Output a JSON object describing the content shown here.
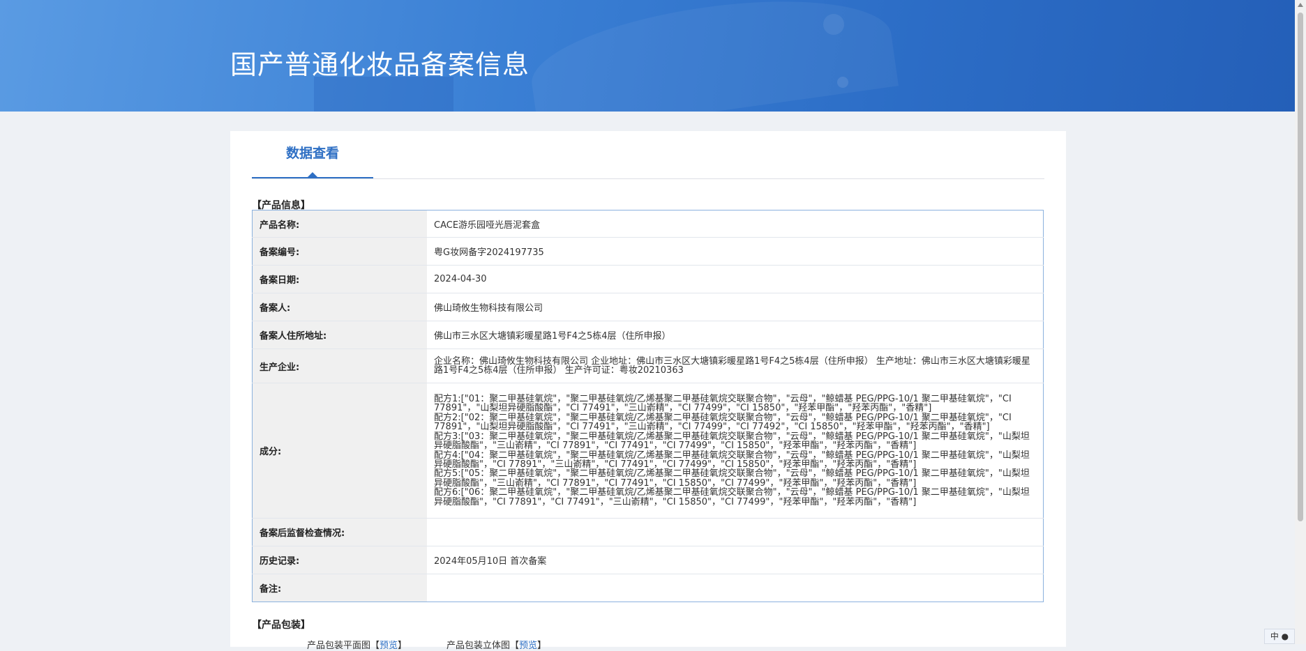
{
  "header": {
    "title": "国产普通化妆品备案信息"
  },
  "tabs": [
    {
      "label": "数据查看"
    }
  ],
  "product_info": {
    "section_title": "【产品信息】",
    "rows": [
      {
        "label": "产品名称:",
        "value": "CACE游乐园哑光唇泥套盒"
      },
      {
        "label": "备案编号:",
        "value": "粤G妆网备字2024197735"
      },
      {
        "label": "备案日期:",
        "value": "2024-04-30"
      },
      {
        "label": "备案人:",
        "value": "佛山琦攸生物科技有限公司"
      },
      {
        "label": "备案人住所地址:",
        "value": "佛山市三水区大塘镇彩暖星路1号F4之5栋4层（住所申报）"
      },
      {
        "label": "生产企业:",
        "value": "企业名称：佛山琦攸生物科技有限公司 企业地址：佛山市三水区大塘镇彩暖星路1号F4之5栋4层（住所申报） 生产地址：佛山市三水区大塘镇彩暖星路1号F4之5栋4层（住所申报） 生产许可证：粤妆20210363"
      },
      {
        "label": "成分:",
        "value": "配方1:[\"01：聚二甲基硅氧烷\"，\"聚二甲基硅氧烷/乙烯基聚二甲基硅氧烷交联聚合物\"，\"云母\"，\"鲸蜡基 PEG/PPG-10/1 聚二甲基硅氧烷\"，\"CI 77891\"，\"山梨坦异硬脂酸酯\"，\"CI 77491\"，\"三山嵛精\"，\"CI 77499\"，\"CI 15850\"，\"羟苯甲酯\"，\"羟苯丙酯\"，\"香精\"]\n配方2:[\"02：聚二甲基硅氧烷\"，\"聚二甲基硅氧烷/乙烯基聚二甲基硅氧烷交联聚合物\"，\"云母\"，\"鲸蜡基 PEG/PPG-10/1 聚二甲基硅氧烷\"，\"CI 77891\"，\"山梨坦异硬脂酸酯\"，\"CI 77491\"，\"三山嵛精\"，\"CI 77499\"，\"CI 77492\"，\"CI 15850\"，\"羟苯甲酯\"，\"羟苯丙酯\"，\"香精\"]\n配方3:[\"03：聚二甲基硅氧烷\"，\"聚二甲基硅氧烷/乙烯基聚二甲基硅氧烷交联聚合物\"，\"云母\"，\"鲸蜡基 PEG/PPG-10/1 聚二甲基硅氧烷\"，\"山梨坦异硬脂酸酯\"，\"三山嵛精\"，\"CI 77891\"，\"CI 77491\"，\"CI 77499\"，\"CI 15850\"，\"羟苯甲酯\"，\"羟苯丙酯\"，\"香精\"]\n配方4:[\"04：聚二甲基硅氧烷\"，\"聚二甲基硅氧烷/乙烯基聚二甲基硅氧烷交联聚合物\"，\"云母\"，\"鲸蜡基 PEG/PPG-10/1 聚二甲基硅氧烷\"，\"山梨坦异硬脂酸酯\"，\"CI 77891\"，\"三山嵛精\"，\"CI 77491\"，\"CI 77499\"，\"CI 15850\"，\"羟苯甲酯\"，\"羟苯丙酯\"，\"香精\"]\n配方5:[\"05：聚二甲基硅氧烷\"，\"聚二甲基硅氧烷/乙烯基聚二甲基硅氧烷交联聚合物\"，\"云母\"，\"鲸蜡基 PEG/PPG-10/1 聚二甲基硅氧烷\"，\"山梨坦异硬脂酸酯\"，\"三山嵛精\"，\"CI 77891\"，\"CI 77491\"，\"CI 15850\"，\"CI 77499\"，\"羟苯甲酯\"，\"羟苯丙酯\"，\"香精\"]\n配方6:[\"06：聚二甲基硅氧烷\"，\"聚二甲基硅氧烷/乙烯基聚二甲基硅氧烷交联聚合物\"，\"云母\"，\"鲸蜡基 PEG/PPG-10/1 聚二甲基硅氧烷\"，\"山梨坦异硬脂酸酯\"，\"CI 77891\"，\"CI 77491\"，\"三山嵛精\"，\"CI 15850\"，\"CI 77499\"，\"羟苯甲酯\"，\"羟苯丙酯\"，\"香精\"]"
      },
      {
        "label": "备案后监督检查情况:",
        "value": ""
      },
      {
        "label": "历史记录:",
        "value": "2024年05月10日 首次备案"
      },
      {
        "label": "备注:",
        "value": ""
      }
    ]
  },
  "packaging": {
    "section_title": "【产品包装】",
    "items": [
      {
        "label": "产品包装平面图",
        "bracket_open": "【",
        "link": "预览",
        "bracket_close": "】"
      },
      {
        "label": "产品包装立体图",
        "bracket_open": "【",
        "link": "预览",
        "bracket_close": "】"
      }
    ]
  },
  "ime": {
    "label": "中",
    "icon": "mouse-icon"
  }
}
